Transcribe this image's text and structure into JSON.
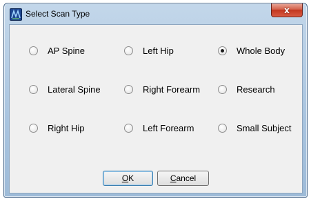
{
  "window": {
    "title": "Select Scan Type",
    "close_label": "x"
  },
  "options": [
    {
      "label": "AP Spine",
      "checked": false
    },
    {
      "label": "Left Hip",
      "checked": false
    },
    {
      "label": "Whole Body",
      "checked": true
    },
    {
      "label": "Lateral Spine",
      "checked": false
    },
    {
      "label": "Right Forearm",
      "checked": false
    },
    {
      "label": "Research",
      "checked": false
    },
    {
      "label": "Right Hip",
      "checked": false
    },
    {
      "label": "Left Forearm",
      "checked": false
    },
    {
      "label": "Small Subject",
      "checked": false
    }
  ],
  "buttons": {
    "ok_accel": "O",
    "ok_rest": "K",
    "cancel_accel": "C",
    "cancel_rest": "ancel"
  }
}
